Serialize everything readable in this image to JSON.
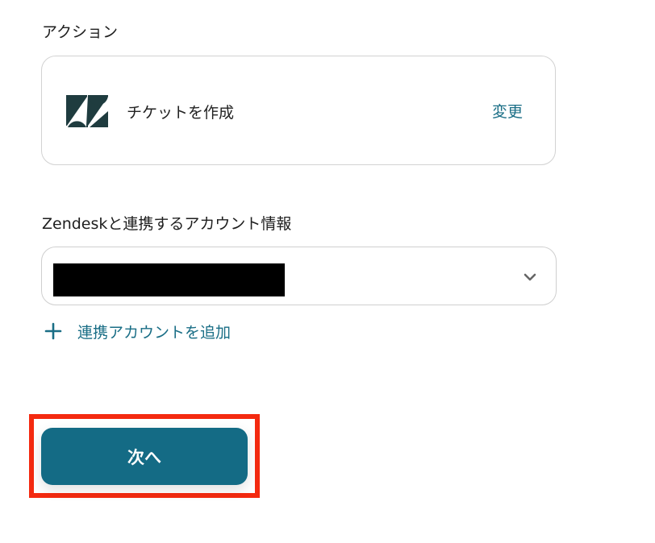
{
  "action_section": {
    "label": "アクション",
    "app_icon": "zendesk-logo-icon",
    "action_name": "チケットを作成",
    "change_label": "変更"
  },
  "account_section": {
    "label": "Zendeskと連携するアカウント情報",
    "selected_value": "",
    "selected_value_redacted": true,
    "dropdown_icon": "chevron-down-icon",
    "add_account_icon": "plus-icon",
    "add_account_label": "連携アカウントを追加"
  },
  "footer": {
    "next_label": "次へ"
  },
  "colors": {
    "accent": "#1a6e86",
    "button_bg": "#146b85",
    "highlight": "#f42a10",
    "logo": "#1f3c3f",
    "border": "#d2d2d2"
  }
}
